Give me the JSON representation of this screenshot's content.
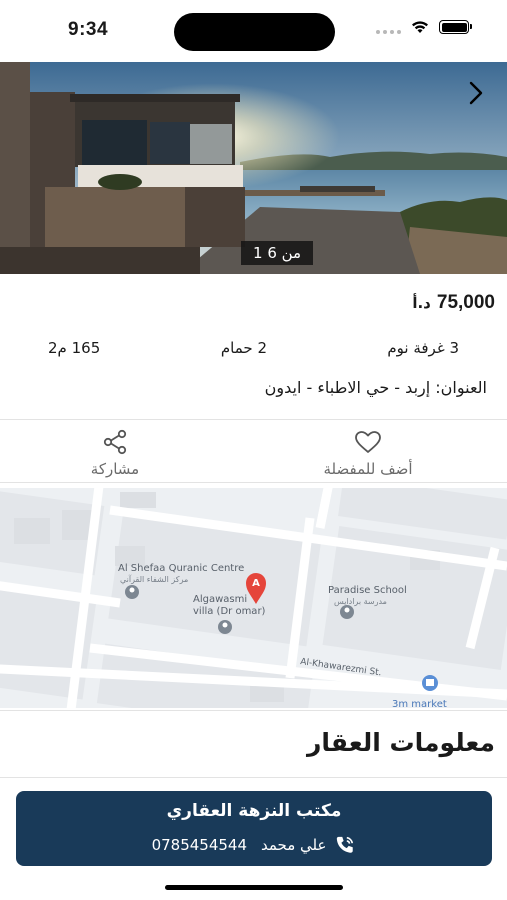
{
  "status_bar": {
    "time": "9:34",
    "icons": [
      "cellular-icon",
      "wifi-icon",
      "battery-icon"
    ]
  },
  "gallery": {
    "counter": "1 من 6",
    "next_icon": "chevron-right-icon"
  },
  "listing": {
    "price": "75,000",
    "currency": "د.أ",
    "bedrooms": "3 غرفة نوم",
    "bathrooms": "2 حمام",
    "area": "165 م2",
    "address": "العنوان: إربد - حي الاطباء - ايدون"
  },
  "actions": {
    "favorite": {
      "label": "أضف للمفضلة",
      "icon": "heart-icon"
    },
    "share": {
      "label": "مشاركة",
      "icon": "share-icon"
    }
  },
  "map": {
    "marker_letter": "A",
    "places": [
      {
        "name": "Al Shefaa Quranic Centre",
        "name_ar": "مركز الشفاء القرآني"
      },
      {
        "name": "Algawasmi",
        "sub": "villa (Dr omar)"
      },
      {
        "name": "Paradise School",
        "name_ar": "مدرسة برادايس"
      },
      {
        "name": "3m market"
      }
    ],
    "street": "Al-Khawarezmi St."
  },
  "section": {
    "title": "معلومات العقار"
  },
  "agent": {
    "office": "مكتب النزهة العقاري",
    "name": "علي محمد",
    "phone": "0785454544",
    "phone_icon": "phone-icon"
  },
  "colors": {
    "agent_card": "#193a59",
    "map_pin": "#e5453b",
    "poi_blue": "#5a8fd6"
  }
}
